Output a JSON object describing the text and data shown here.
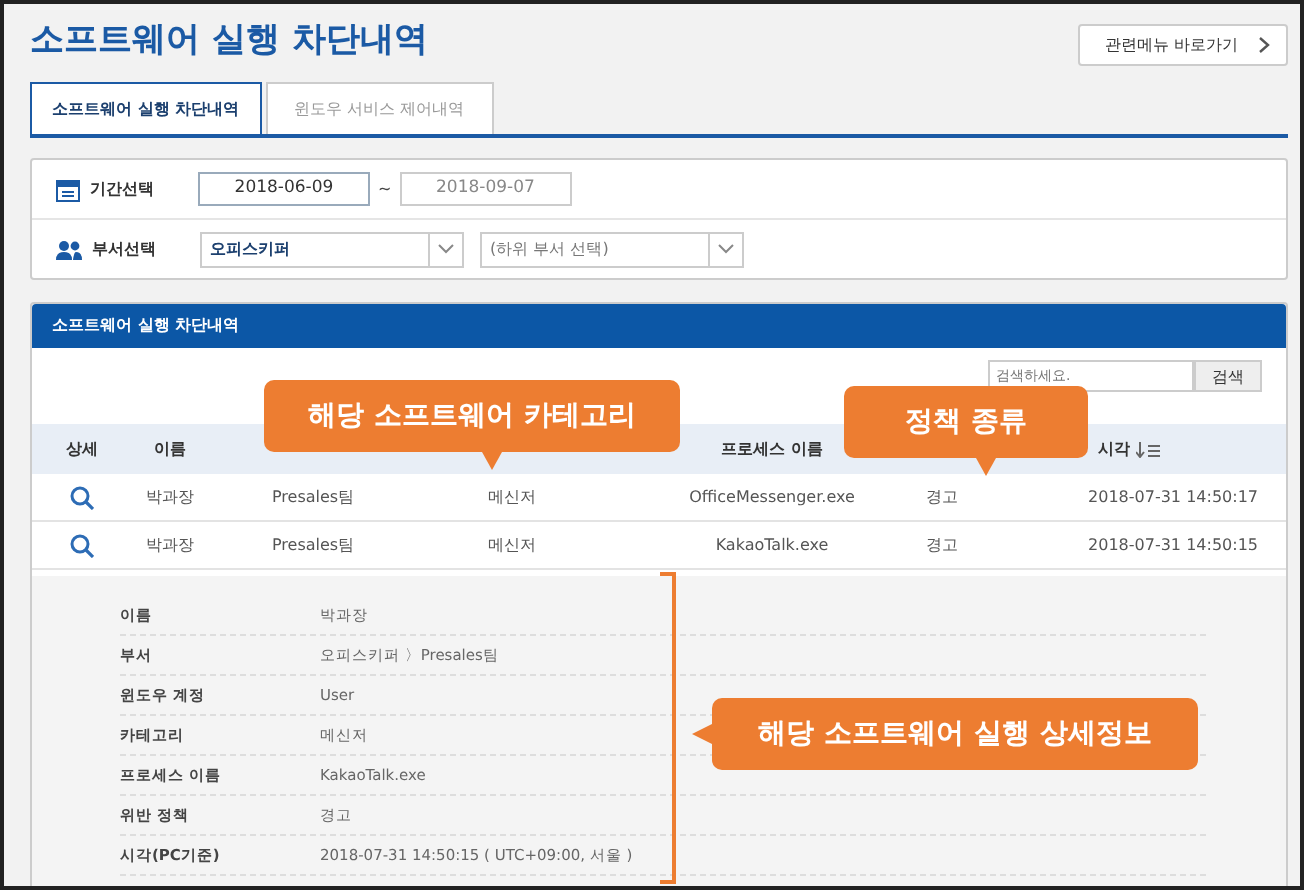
{
  "page_title": "소프트웨어 실행 차단내역",
  "related_menu_button": "관련메뉴 바로가기",
  "tabs": [
    {
      "label": "소프트웨어 실행 차단내역",
      "selected": true
    },
    {
      "label": "윈도우 서비스 제어내역",
      "selected": false
    }
  ],
  "filters": {
    "period_label": "기간선택",
    "date_from": "2018-06-09",
    "date_separator": "~",
    "date_to": "2018-09-07",
    "department_label": "부서선택",
    "department": "오피스키퍼",
    "sub_department": {
      "placeholder": "(하위 부서 선택)"
    }
  },
  "panel": {
    "title": "소프트웨어 실행 차단내역",
    "search": {
      "placeholder": "검색하세요.",
      "button": "검색"
    }
  },
  "table": {
    "columns": [
      {
        "label": "상세"
      },
      {
        "label": "이름"
      },
      {
        "label": "프로세스 이름"
      },
      {
        "label": "시각"
      }
    ],
    "rows": [
      {
        "name": "박과장",
        "department": "Presales팀",
        "category": "메신저",
        "process": "OfficeMessenger.exe",
        "policy": "경고",
        "time": "2018-07-31 14:50:17"
      },
      {
        "name": "박과장",
        "department": "Presales팀",
        "category": "메신저",
        "process": "KakaoTalk.exe",
        "policy": "경고",
        "time": "2018-07-31 14:50:15"
      }
    ]
  },
  "detail": [
    {
      "label": "이름",
      "value": "박과장"
    },
    {
      "label": "부서",
      "value": "오피스키퍼 〉Presales팀"
    },
    {
      "label": "윈도우 계정",
      "value": "User"
    },
    {
      "label": "카테고리",
      "value": "메신저"
    },
    {
      "label": "프로세스 이름",
      "value": "KakaoTalk.exe"
    },
    {
      "label": "위반 정책",
      "value": "경고"
    },
    {
      "label": "시각(PC기준)",
      "value": "2018-07-31 14:50:15 ( UTC+09:00, 서울 )"
    }
  ],
  "callouts": [
    {
      "text": "해당 소프트웨어 카테고리",
      "kind": "down"
    },
    {
      "text": "정책 종류",
      "kind": "down"
    },
    {
      "text": "해당 소프트웨어 실행 상세정보",
      "kind": "left"
    }
  ]
}
